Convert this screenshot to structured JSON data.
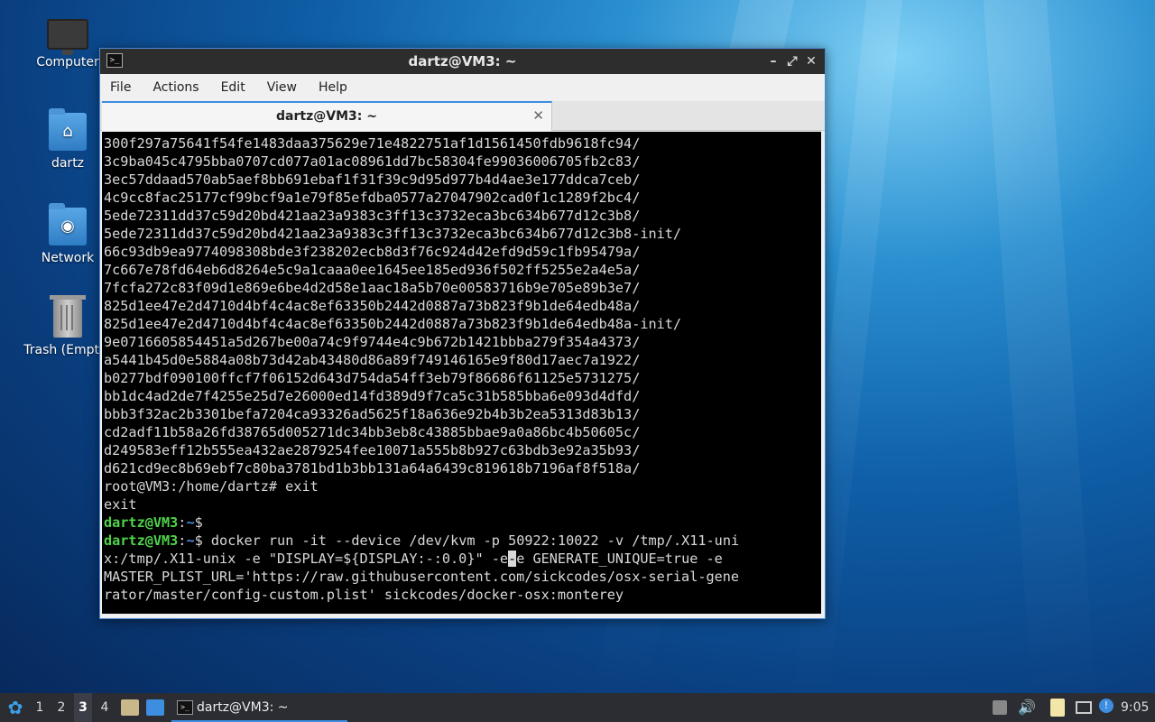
{
  "desktop": {
    "icons": [
      {
        "label": "Computer"
      },
      {
        "label": "dartz"
      },
      {
        "label": "Network"
      },
      {
        "label": "Trash (Empty)"
      }
    ]
  },
  "window": {
    "title": "dartz@VM3: ~",
    "controls": {
      "minimize": "–",
      "maximize": "⤢",
      "close": "✕"
    },
    "menu": [
      "File",
      "Actions",
      "Edit",
      "View",
      "Help"
    ],
    "tab": {
      "label": "dartz@VM3: ~",
      "close": "✕"
    }
  },
  "terminal": {
    "lines": [
      "300f297a75641f54fe1483daa375629e71e4822751af1d1561450fdb9618fc94/",
      "3c9ba045c4795bba0707cd077a01ac08961dd7bc58304fe99036006705fb2c83/",
      "3ec57ddaad570ab5aef8bb691ebaf1f31f39c9d95d977b4d4ae3e177ddca7ceb/",
      "4c9cc8fac25177cf99bcf9a1e79f85efdba0577a27047902cad0f1c1289f2bc4/",
      "5ede72311dd37c59d20bd421aa23a9383c3ff13c3732eca3bc634b677d12c3b8/",
      "5ede72311dd37c59d20bd421aa23a9383c3ff13c3732eca3bc634b677d12c3b8-init/",
      "66c93db9ea9774098308bde3f238202ecb8d3f76c924d42efd9d59c1fb95479a/",
      "7c667e78fd64eb6d8264e5c9a1caaa0ee1645ee185ed936f502ff5255e2a4e5a/",
      "7fcfa272c83f09d1e869e6be4d2d58e1aac18a5b70e00583716b9e705e89b3e7/",
      "825d1ee47e2d4710d4bf4c4ac8ef63350b2442d0887a73b823f9b1de64edb48a/",
      "825d1ee47e2d4710d4bf4c4ac8ef63350b2442d0887a73b823f9b1de64edb48a-init/",
      "9e0716605854451a5d267be00a74c9f9744e4c9b672b1421bbba279f354a4373/",
      "a5441b45d0e5884a08b73d42ab43480d86a89f749146165e9f80d17aec7a1922/",
      "b0277bdf090100ffcf7f06152d643d754da54ff3eb79f86686f61125e5731275/",
      "bb1dc4ad2de7f4255e25d7e26000ed14fd389d9f7ca5c31b585bba6e093d4dfd/",
      "bbb3f32ac2b3301befa7204ca93326ad5625f18a636e92b4b3b2ea5313d83b13/",
      "cd2adf11b58a26fd38765d005271dc34bb3eb8c43885bbae9a0a86bc4b50605c/",
      "d249583eff12b555ea432ae2879254fee10071a555b8b927c63bdb3e92a35b93/",
      "d621cd9ec8b69ebf7c80ba3781bd1b3bb131a64a6439c819618b7196af8f518a/",
      "root@VM3:/home/dartz# exit",
      "exit"
    ],
    "prompt_user": "dartz@VM3",
    "prompt_sep": ":",
    "prompt_path": "~",
    "prompt_end": "$",
    "command_lines": [
      " docker run -it --device /dev/kvm -p 50922:10022 -v /tmp/.X11-uni",
      "x:/tmp/.X11-unix -e \"DISPLAY=${DISPLAY:-:0.0}\" -e",
      "MASTER_PLIST_URL='https://raw.githubusercontent.com/sickcodes/osx-serial-gene",
      "rator/master/config-custom.plist' sickcodes/docker-osx:monterey"
    ],
    "cursor_char": "-",
    "after_cursor": "e GENERATE_UNIQUE=true -e"
  },
  "taskbar": {
    "workspaces": [
      "1",
      "2",
      "3",
      "4"
    ],
    "active_workspace": "3",
    "task_label": "dartz@VM3: ~",
    "clock": "9:05"
  }
}
